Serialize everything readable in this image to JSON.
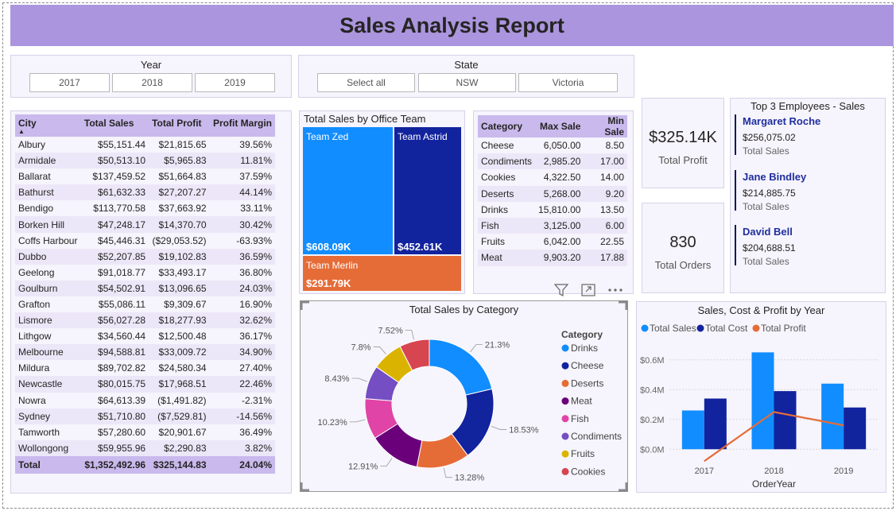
{
  "title": "Sales Analysis Report",
  "year_slicer": {
    "title": "Year",
    "options": [
      "2017",
      "2018",
      "2019"
    ]
  },
  "state_slicer": {
    "title": "State",
    "options": [
      "Select all",
      "NSW",
      "Victoria"
    ]
  },
  "city_table": {
    "headers": [
      "City",
      "Total Sales",
      "Total Profit",
      "Profit Margin"
    ],
    "rows": [
      [
        "Albury",
        "$55,151.44",
        "$21,815.65",
        "39.56%"
      ],
      [
        "Armidale",
        "$50,513.10",
        "$5,965.83",
        "11.81%"
      ],
      [
        "Ballarat",
        "$137,459.52",
        "$51,664.83",
        "37.59%"
      ],
      [
        "Bathurst",
        "$61,632.33",
        "$27,207.27",
        "44.14%"
      ],
      [
        "Bendigo",
        "$113,770.58",
        "$37,663.92",
        "33.11%"
      ],
      [
        "Borken Hill",
        "$47,248.17",
        "$14,370.70",
        "30.42%"
      ],
      [
        "Coffs Harbour",
        "$45,446.31",
        "($29,053.52)",
        "-63.93%"
      ],
      [
        "Dubbo",
        "$52,207.85",
        "$19,102.83",
        "36.59%"
      ],
      [
        "Geelong",
        "$91,018.77",
        "$33,493.17",
        "36.80%"
      ],
      [
        "Goulburn",
        "$54,502.91",
        "$13,096.65",
        "24.03%"
      ],
      [
        "Grafton",
        "$55,086.11",
        "$9,309.67",
        "16.90%"
      ],
      [
        "Lismore",
        "$56,027.28",
        "$18,277.93",
        "32.62%"
      ],
      [
        "Lithgow",
        "$34,560.44",
        "$12,500.48",
        "36.17%"
      ],
      [
        "Melbourne",
        "$94,588.81",
        "$33,009.72",
        "34.90%"
      ],
      [
        "Mildura",
        "$89,702.82",
        "$24,580.34",
        "27.40%"
      ],
      [
        "Newcastle",
        "$80,015.75",
        "$17,968.51",
        "22.46%"
      ],
      [
        "Nowra",
        "$64,613.39",
        "($1,491.82)",
        "-2.31%"
      ],
      [
        "Sydney",
        "$51,710.80",
        "($7,529.81)",
        "-14.56%"
      ],
      [
        "Tamworth",
        "$57,280.60",
        "$20,901.67",
        "36.49%"
      ],
      [
        "Wollongong",
        "$59,955.96",
        "$2,290.83",
        "3.82%"
      ]
    ],
    "total": [
      "Total",
      "$1,352,492.96",
      "$325,144.83",
      "24.04%"
    ]
  },
  "treemap": {
    "title": "Total Sales by Office Team",
    "items": [
      {
        "name": "Team Zed",
        "value_label": "$608.09K",
        "value": 608.09,
        "color": "#118dff"
      },
      {
        "name": "Team Astrid",
        "value_label": "$452.61K",
        "value": 452.61,
        "color": "#12239e"
      },
      {
        "name": "Team Merlin",
        "value_label": "$291.79K",
        "value": 291.79,
        "color": "#e66c37"
      }
    ]
  },
  "category_table": {
    "headers": [
      "Category",
      "Max Sale",
      "Min Sale"
    ],
    "rows": [
      [
        "Cheese",
        "6,050.00",
        "8.50"
      ],
      [
        "Condiments",
        "2,985.20",
        "17.00"
      ],
      [
        "Cookies",
        "4,322.50",
        "14.00"
      ],
      [
        "Deserts",
        "5,268.00",
        "9.20"
      ],
      [
        "Drinks",
        "15,810.00",
        "13.50"
      ],
      [
        "Fish",
        "3,125.00",
        "6.00"
      ],
      [
        "Fruits",
        "6,042.00",
        "22.55"
      ],
      [
        "Meat",
        "9,903.20",
        "17.88"
      ]
    ]
  },
  "kpi_profit": {
    "value": "$325.14K",
    "label": "Total Profit"
  },
  "kpi_orders": {
    "value": "830",
    "label": "Total Orders"
  },
  "top_employees": {
    "title": "Top 3 Employees - Sales",
    "items": [
      {
        "name": "Margaret Roche",
        "value": "$256,075.02",
        "label": "Total Sales"
      },
      {
        "name": "Jane Bindley",
        "value": "$214,885.75",
        "label": "Total Sales"
      },
      {
        "name": "David Bell",
        "value": "$204,688.51",
        "label": "Total Sales"
      }
    ]
  },
  "chart_data": [
    {
      "type": "pie",
      "title": "Total Sales by Category",
      "legend_title": "Category",
      "legend_position": "right",
      "donut": true,
      "slices": [
        {
          "name": "Drinks",
          "value": 21.3,
          "label": "21.3%",
          "color": "#118dff"
        },
        {
          "name": "Cheese",
          "value": 18.53,
          "label": "18.53%",
          "color": "#12239e"
        },
        {
          "name": "Deserts",
          "value": 13.28,
          "label": "13.28%",
          "color": "#e66c37"
        },
        {
          "name": "Meat",
          "value": 12.91,
          "label": "12.91%",
          "color": "#6b007b"
        },
        {
          "name": "Fish",
          "value": 10.23,
          "label": "10.23%",
          "color": "#e044a7"
        },
        {
          "name": "Condiments",
          "value": 8.43,
          "label": "8.43%",
          "color": "#744ec2"
        },
        {
          "name": "Fruits",
          "value": 7.8,
          "label": "7.8%",
          "color": "#d9b300"
        },
        {
          "name": "Cookies",
          "value": 7.52,
          "label": "7.52%",
          "color": "#d64550"
        }
      ]
    },
    {
      "type": "bar",
      "title": "Sales, Cost & Profit by Year",
      "xlabel": "OrderYear",
      "ylabel": "",
      "legend_position": "top-left",
      "categories": [
        "2017",
        "2018",
        "2019"
      ],
      "ylim": [
        -0.1,
        0.7
      ],
      "yticks": [
        0,
        0.2,
        0.4,
        0.6
      ],
      "ytick_labels": [
        "$0.0M",
        "$0.2M",
        "$0.4M",
        "$0.6M"
      ],
      "series": [
        {
          "name": "Total Sales",
          "kind": "bar",
          "values": [
            0.26,
            0.65,
            0.44
          ],
          "color": "#118dff"
        },
        {
          "name": "Total Cost",
          "kind": "bar",
          "values": [
            0.34,
            0.39,
            0.28
          ],
          "color": "#12239e"
        },
        {
          "name": "Total Profit",
          "kind": "line",
          "values": [
            -0.08,
            0.25,
            0.16
          ],
          "color": "#e66c37"
        }
      ]
    }
  ]
}
